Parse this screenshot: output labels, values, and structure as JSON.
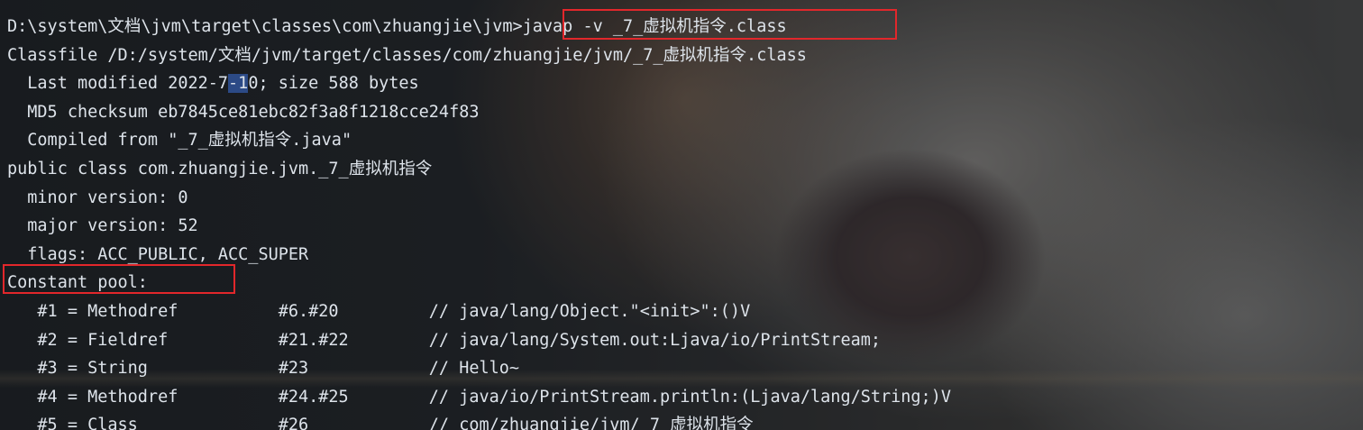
{
  "prompt": {
    "path": "D:\\system\\文档\\jvm\\target\\classes\\com\\zhuangjie\\jvm>",
    "command": "javap -v _7_虚拟机指令.class"
  },
  "classfile_line": "Classfile /D:/system/文档/jvm/target/classes/com/zhuangjie/jvm/_7_虚拟机指令.class",
  "last_modified": {
    "prefix": "  Last modified 2022-7",
    "selected": "-1",
    "suffix": "0; size 588 bytes"
  },
  "md5_line": "  MD5 checksum eb7845ce81ebc82f3a8f1218cce24f83",
  "compiled_line": "  Compiled from \"_7_虚拟机指令.java\"",
  "class_decl": "public class com.zhuangjie.jvm._7_虚拟机指令",
  "minor_version": "  minor version: 0",
  "major_version": "  major version: 52",
  "flags": "  flags: ACC_PUBLIC, ACC_SUPER",
  "constant_pool_header": "Constant pool:",
  "constant_pool": [
    "   #1 = Methodref          #6.#20         // java/lang/Object.\"<init>\":()V",
    "   #2 = Fieldref           #21.#22        // java/lang/System.out:Ljava/io/PrintStream;",
    "   #3 = String             #23            // Hello~",
    "   #4 = Methodref          #24.#25        // java/io/PrintStream.println:(Ljava/lang/String;)V",
    "   #5 = Class              #26            // com/zhuangjie/jvm/_7_虚拟机指令"
  ],
  "colors": {
    "text": "#dde3ea",
    "highlight_box": "#e2272b",
    "selection": "#2c4a86"
  }
}
